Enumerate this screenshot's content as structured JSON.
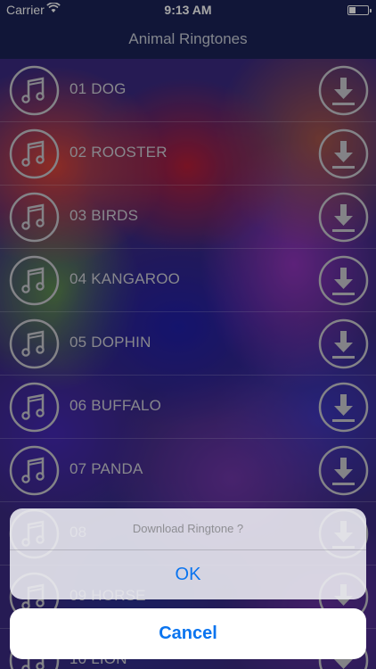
{
  "status_bar": {
    "carrier": "Carrier",
    "time": "9:13 AM"
  },
  "nav": {
    "title": "Animal Ringtones"
  },
  "ringtones": [
    {
      "label": "01 DOG"
    },
    {
      "label": "02 ROOSTER"
    },
    {
      "label": "03 BIRDS"
    },
    {
      "label": "04 KANGAROO"
    },
    {
      "label": "05 DOPHIN"
    },
    {
      "label": "06 BUFFALO"
    },
    {
      "label": "07 PANDA"
    },
    {
      "label": "08"
    },
    {
      "label": "09 HORSE"
    },
    {
      "label": "10 LION"
    }
  ],
  "icons": {
    "row_left": "music-note-icon",
    "row_right": "download-icon"
  },
  "alert": {
    "title": "Download Ringtone ?",
    "ok_label": "OK",
    "cancel_label": "Cancel"
  },
  "colors": {
    "nav_bg": "#1b2357",
    "accent": "#0a74ef"
  }
}
